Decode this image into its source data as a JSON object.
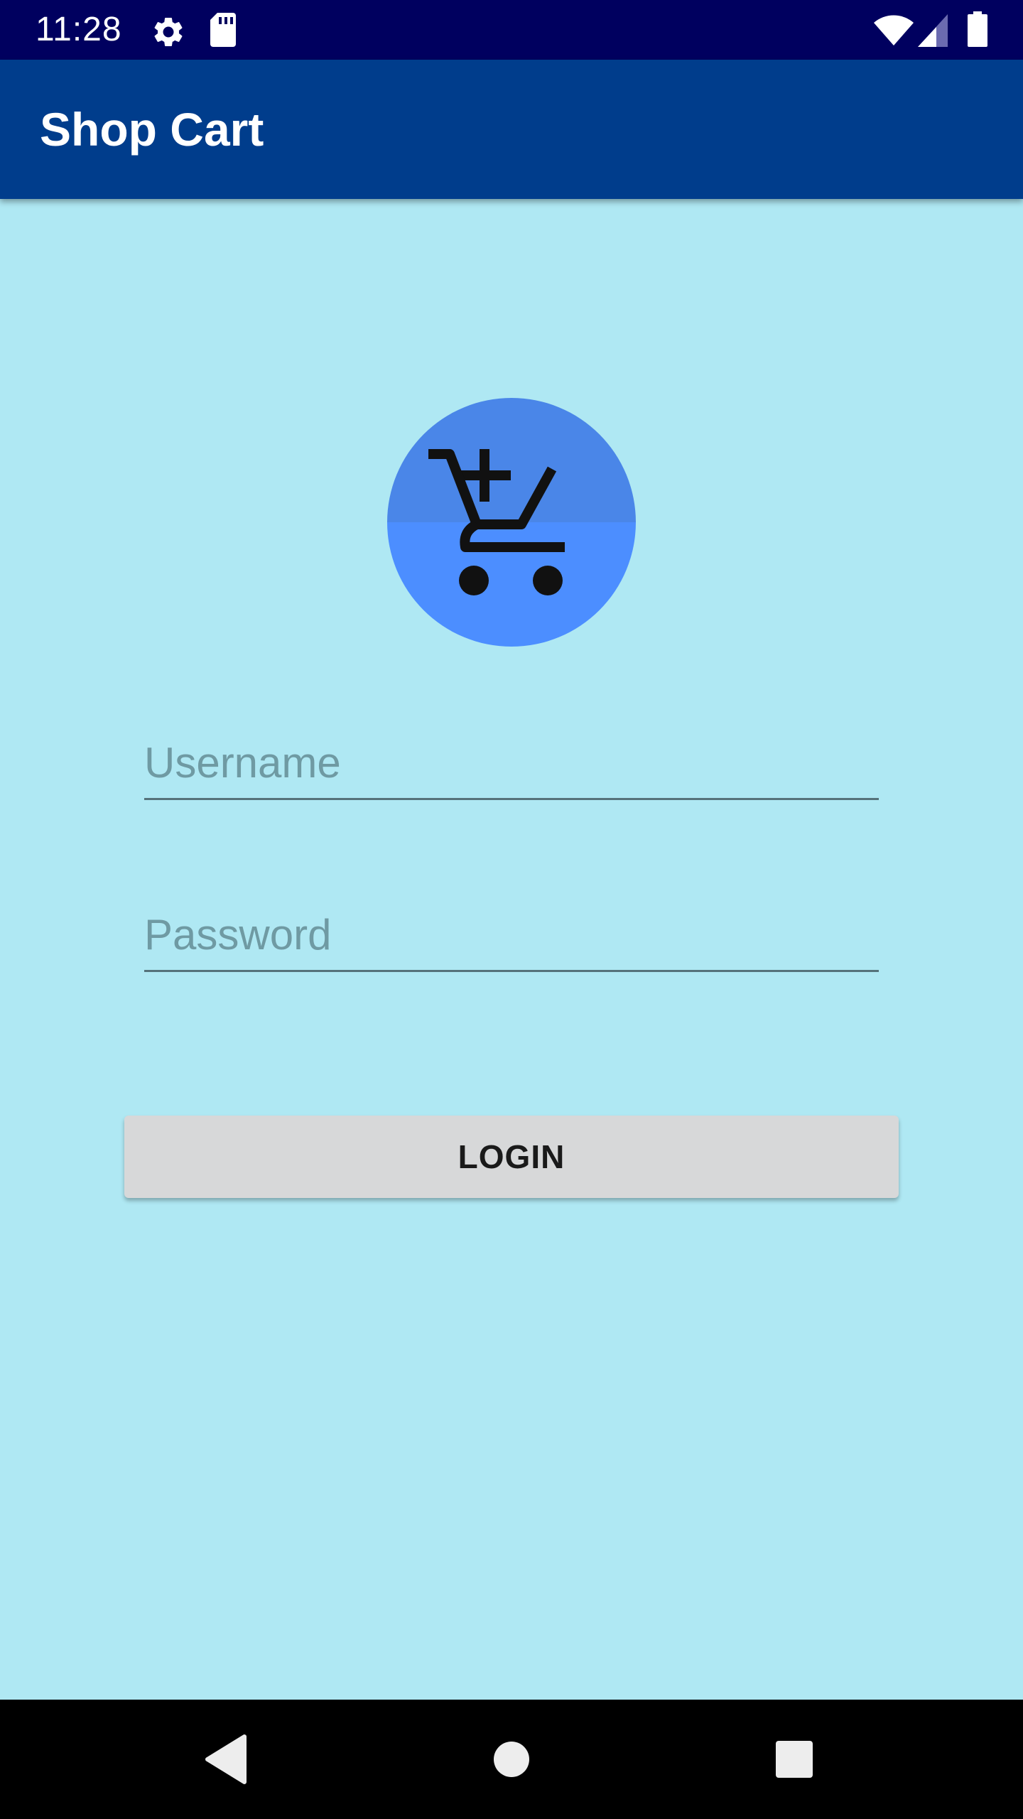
{
  "status_bar": {
    "time": "11:28",
    "icons": [
      "gear-icon",
      "sd-card-icon",
      "wifi-icon",
      "signal-icon",
      "battery-icon"
    ]
  },
  "app_bar": {
    "title": "Shop Cart"
  },
  "logo": {
    "icon": "add-shopping-cart-icon"
  },
  "form": {
    "username_placeholder": "Username",
    "username_value": "",
    "password_placeholder": "Password",
    "password_value": "",
    "login_label": "LOGIN"
  },
  "nav_bar": {
    "icons": [
      "back-icon",
      "home-icon",
      "recents-icon"
    ]
  },
  "colors": {
    "status_bar": "#00005f",
    "app_bar": "#003d8c",
    "background": "#afe8f3",
    "logo_top": "#4a86e8",
    "logo_bottom": "#4c8eff",
    "button": "#d7d8d9"
  }
}
